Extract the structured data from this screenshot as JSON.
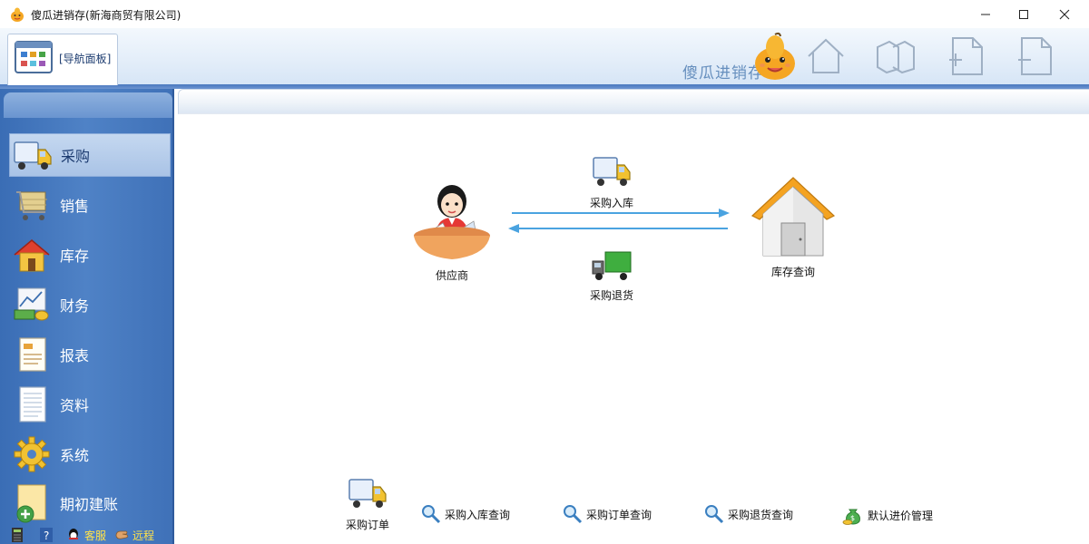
{
  "window": {
    "title": "傻瓜进销存(新海商贸有限公司)"
  },
  "ribbon": {
    "nav_tab_label": "[导航面板]",
    "brand_text": "傻瓜进销存"
  },
  "sidebar": {
    "items": [
      {
        "label": "采购",
        "icon": "truck-icon",
        "active": true
      },
      {
        "label": "销售",
        "icon": "shopping-cart-icon",
        "active": false
      },
      {
        "label": "库存",
        "icon": "house-icon",
        "active": false
      },
      {
        "label": "财务",
        "icon": "finance-chart-icon",
        "active": false
      },
      {
        "label": "报表",
        "icon": "report-icon",
        "active": false
      },
      {
        "label": "资料",
        "icon": "document-icon",
        "active": false
      },
      {
        "label": "系统",
        "icon": "gear-icon",
        "active": false
      },
      {
        "label": "期初建账",
        "icon": "new-folder-icon",
        "active": false
      }
    ],
    "bottom": {
      "service_label": "客服",
      "remote_label": "远程"
    }
  },
  "flow": {
    "supplier_label": "供应商",
    "purchase_in_label": "采购入库",
    "purchase_return_label": "采购退货",
    "stock_query_label": "库存查询"
  },
  "bottom_links": {
    "purchase_order": "采购订单",
    "purchase_in_query": "采购入库查询",
    "purchase_order_query": "采购订单查询",
    "purchase_return_query": "采购退货查询",
    "default_price_mgmt": "默认进价管理"
  },
  "colors": {
    "sidebar_bg": "#4f82c6",
    "accent": "#4aa3e0",
    "brand_yellow": "#ffe24a"
  }
}
